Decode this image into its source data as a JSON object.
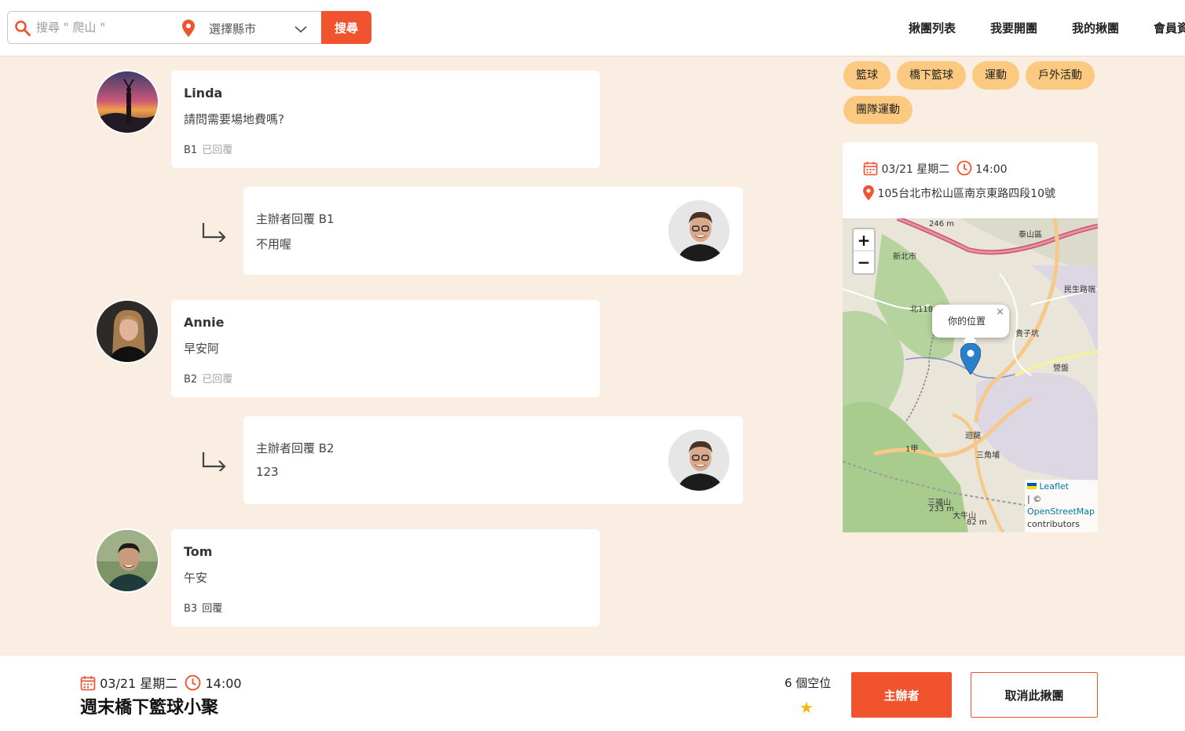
{
  "header": {
    "search_placeholder": "搜尋 \" 爬山 \"",
    "city_label": "選擇縣市",
    "search_button": "搜尋",
    "nav": [
      "揪團列表",
      "我要開團",
      "我的揪團",
      "會員資"
    ]
  },
  "comments": [
    {
      "name": "Linda",
      "text": "請問需要場地費嗎?",
      "floor": "B1",
      "status": "已回覆",
      "reply": {
        "title": "主辦者回覆 B1",
        "text": "不用喔"
      }
    },
    {
      "name": "Annie",
      "text": "早安阿",
      "floor": "B2",
      "status": "已回覆",
      "reply": {
        "title": "主辦者回覆 B2",
        "text": "123"
      }
    },
    {
      "name": "Tom",
      "text": "午安",
      "floor": "B3",
      "status": "回覆"
    }
  ],
  "sidebar": {
    "tags": [
      "籃球",
      "橋下籃球",
      "運動",
      "戶外活動",
      "團隊運動"
    ],
    "date": "03/21 星期二",
    "time": "14:00",
    "address": "105台北市松山區南京東路四段10號"
  },
  "map": {
    "zoom_in": "+",
    "zoom_out": "−",
    "popup": "你的位置",
    "popup_close": "×",
    "attribution_leaflet": "Leaflet",
    "attribution_sep": "| ©",
    "attribution_osm": "OpenStreetMap",
    "attribution_contrib": "contributors",
    "labels": [
      "泰山區",
      "新北市",
      "北118",
      "貴子坑",
      "營盤",
      "三角埔",
      "迴龍",
      "1甲",
      "大牛山",
      "三福山",
      "民生路端",
      "246 m",
      "233 m",
      "82 m"
    ]
  },
  "footer": {
    "date": "03/21 星期二",
    "time": "14:00",
    "title": "週末橋下籃球小聚",
    "slots": "6 個空位",
    "host_button": "主辦者",
    "cancel_button": "取消此揪團"
  },
  "colors": {
    "accent": "#f1532f",
    "tag": "#fbc97f",
    "background": "#faede2"
  }
}
